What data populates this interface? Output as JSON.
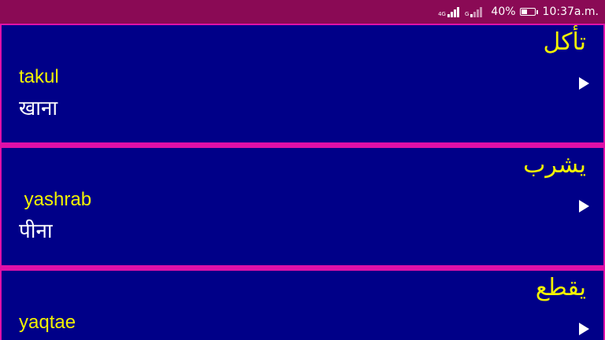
{
  "status_bar": {
    "network_1": "4G",
    "network_2": "G",
    "battery_percent": "40%",
    "battery_level": 0.4,
    "time": "10:37a.m."
  },
  "icons": {
    "signal": "signal-bars-icon",
    "battery": "battery-icon",
    "play": "play-icon"
  },
  "colors": {
    "card_background": "#000088",
    "divider": "#e010a8",
    "status_bar": "#8a0a55",
    "arabic_text": "#f2f200",
    "transliteration_text": "#f2f200",
    "hindi_text": "#ffffff"
  },
  "words": [
    {
      "arabic": "تأكل",
      "transliteration": "takul",
      "hindi": "खाना"
    },
    {
      "arabic": "يشرب",
      "transliteration": " yashrab",
      "hindi": "पीना"
    },
    {
      "arabic": "يقطع",
      "transliteration": "yaqtae",
      "hindi": ""
    }
  ]
}
